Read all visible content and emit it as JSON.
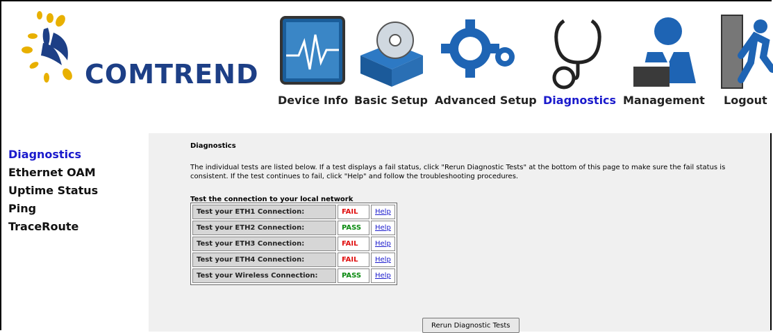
{
  "brand": {
    "name": "COMTREND"
  },
  "nav": {
    "items": [
      {
        "label": "Device Info",
        "icon": "device-info-icon",
        "active": false
      },
      {
        "label": "Basic Setup",
        "icon": "basic-setup-icon",
        "active": false
      },
      {
        "label": "Advanced Setup",
        "icon": "advanced-setup-icon",
        "active": false
      },
      {
        "label": "Diagnostics",
        "icon": "stethoscope-icon",
        "active": true
      },
      {
        "label": "Management",
        "icon": "management-icon",
        "active": false
      },
      {
        "label": "Logout",
        "icon": "logout-icon",
        "active": false
      }
    ]
  },
  "sidebar": {
    "items": [
      {
        "label": "Diagnostics",
        "active": true
      },
      {
        "label": "Ethernet OAM",
        "active": false
      },
      {
        "label": "Uptime Status",
        "active": false
      },
      {
        "label": "Ping",
        "active": false
      },
      {
        "label": "TraceRoute",
        "active": false
      }
    ]
  },
  "main": {
    "title": "Diagnostics",
    "description": "The individual tests are listed below. If a test displays a fail status, click \"Rerun Diagnostic Tests\" at the bottom of this page to make sure the fail status is consistent. If the test continues to fail, click \"Help\" and follow the troubleshooting procedures.",
    "section_title": "Test the connection to your local network",
    "tests": [
      {
        "name": "Test your ETH1 Connection:",
        "status": "FAIL",
        "help": "Help"
      },
      {
        "name": "Test your ETH2 Connection:",
        "status": "PASS",
        "help": "Help"
      },
      {
        "name": "Test your ETH3 Connection:",
        "status": "FAIL",
        "help": "Help"
      },
      {
        "name": "Test your ETH4 Connection:",
        "status": "FAIL",
        "help": "Help"
      },
      {
        "name": "Test your Wireless Connection:",
        "status": "PASS",
        "help": "Help"
      }
    ],
    "rerun_label": "Rerun Diagnostic Tests"
  },
  "colors": {
    "brand": "#1d3f86",
    "active_link": "#1a1acc",
    "fail": "#e01010",
    "pass": "#0a8a10",
    "main_bg": "#f0f0f0"
  }
}
